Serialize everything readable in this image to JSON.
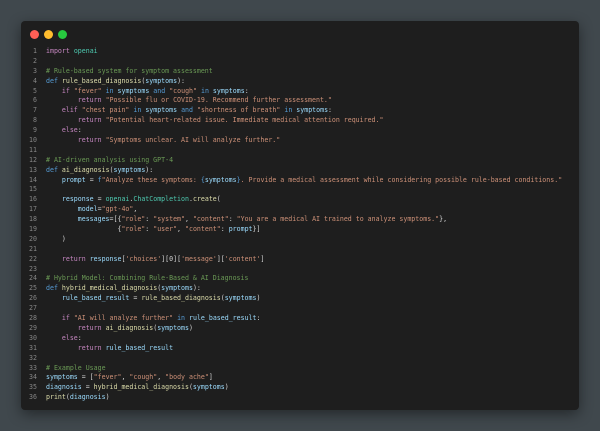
{
  "window": {
    "controls": {
      "close": "#ff5f56",
      "minimize": "#ffbd2e",
      "maximize": "#27c93f"
    }
  },
  "code": {
    "language": "python",
    "lines": [
      [
        [
          "kw",
          "import"
        ],
        [
          "pl",
          " "
        ],
        [
          "mod",
          "openai"
        ]
      ],
      [],
      [
        [
          "cm",
          "# Rule-based system for symptom assessment"
        ]
      ],
      [
        [
          "kb",
          "def"
        ],
        [
          "pl",
          " "
        ],
        [
          "fn",
          "rule_based_diagnosis"
        ],
        [
          "pl",
          "("
        ],
        [
          "var",
          "symptoms"
        ],
        [
          "pl",
          "):"
        ]
      ],
      [
        [
          "pl",
          "    "
        ],
        [
          "kw",
          "if"
        ],
        [
          "pl",
          " "
        ],
        [
          "str",
          "\"fever\""
        ],
        [
          "pl",
          " "
        ],
        [
          "kb",
          "in"
        ],
        [
          "pl",
          " "
        ],
        [
          "var",
          "symptoms"
        ],
        [
          "pl",
          " "
        ],
        [
          "kb",
          "and"
        ],
        [
          "pl",
          " "
        ],
        [
          "str",
          "\"cough\""
        ],
        [
          "pl",
          " "
        ],
        [
          "kb",
          "in"
        ],
        [
          "pl",
          " "
        ],
        [
          "var",
          "symptoms"
        ],
        [
          "pl",
          ":"
        ]
      ],
      [
        [
          "pl",
          "        "
        ],
        [
          "kw",
          "return"
        ],
        [
          "pl",
          " "
        ],
        [
          "str",
          "\"Possible flu or COVID-19. Recommend further assessment.\""
        ]
      ],
      [
        [
          "pl",
          "    "
        ],
        [
          "kw",
          "elif"
        ],
        [
          "pl",
          " "
        ],
        [
          "str",
          "\"chest pain\""
        ],
        [
          "pl",
          " "
        ],
        [
          "kb",
          "in"
        ],
        [
          "pl",
          " "
        ],
        [
          "var",
          "symptoms"
        ],
        [
          "pl",
          " "
        ],
        [
          "kb",
          "and"
        ],
        [
          "pl",
          " "
        ],
        [
          "str",
          "\"shortness of breath\""
        ],
        [
          "pl",
          " "
        ],
        [
          "kb",
          "in"
        ],
        [
          "pl",
          " "
        ],
        [
          "var",
          "symptoms"
        ],
        [
          "pl",
          ":"
        ]
      ],
      [
        [
          "pl",
          "        "
        ],
        [
          "kw",
          "return"
        ],
        [
          "pl",
          " "
        ],
        [
          "str",
          "\"Potential heart-related issue. Immediate medical attention required.\""
        ]
      ],
      [
        [
          "pl",
          "    "
        ],
        [
          "kw",
          "else"
        ],
        [
          "pl",
          ":"
        ]
      ],
      [
        [
          "pl",
          "        "
        ],
        [
          "kw",
          "return"
        ],
        [
          "pl",
          " "
        ],
        [
          "str",
          "\"Symptoms unclear. AI will analyze further.\""
        ]
      ],
      [],
      [
        [
          "cm",
          "# AI-driven analysis using GPT-4"
        ]
      ],
      [
        [
          "kb",
          "def"
        ],
        [
          "pl",
          " "
        ],
        [
          "fn",
          "ai_diagnosis"
        ],
        [
          "pl",
          "("
        ],
        [
          "var",
          "symptoms"
        ],
        [
          "pl",
          "):"
        ]
      ],
      [
        [
          "pl",
          "    "
        ],
        [
          "var",
          "prompt"
        ],
        [
          "pl",
          " = "
        ],
        [
          "kb",
          "f"
        ],
        [
          "str",
          "\"Analyze these symptoms: "
        ],
        [
          "kb",
          "{"
        ],
        [
          "var",
          "symptoms"
        ],
        [
          "kb",
          "}"
        ],
        [
          "str",
          ". Provide a medical assessment while considering possible rule-based conditions.\""
        ]
      ],
      [],
      [
        [
          "pl",
          "    "
        ],
        [
          "var",
          "response"
        ],
        [
          "pl",
          " = "
        ],
        [
          "mod",
          "openai"
        ],
        [
          "pl",
          "."
        ],
        [
          "mod",
          "ChatCompletion"
        ],
        [
          "pl",
          "."
        ],
        [
          "fn",
          "create"
        ],
        [
          "pl",
          "("
        ]
      ],
      [
        [
          "pl",
          "        "
        ],
        [
          "var",
          "model"
        ],
        [
          "pl",
          "="
        ],
        [
          "str",
          "\"gpt-4o\""
        ],
        [
          "pl",
          ","
        ]
      ],
      [
        [
          "pl",
          "        "
        ],
        [
          "var",
          "messages"
        ],
        [
          "pl",
          "=[{"
        ],
        [
          "str",
          "\"role\""
        ],
        [
          "pl",
          ": "
        ],
        [
          "str",
          "\"system\""
        ],
        [
          "pl",
          ", "
        ],
        [
          "str",
          "\"content\""
        ],
        [
          "pl",
          ": "
        ],
        [
          "str",
          "\"You are a medical AI trained to analyze symptoms.\""
        ],
        [
          "pl",
          "},"
        ]
      ],
      [
        [
          "pl",
          "                  {"
        ],
        [
          "str",
          "\"role\""
        ],
        [
          "pl",
          ": "
        ],
        [
          "str",
          "\"user\""
        ],
        [
          "pl",
          ", "
        ],
        [
          "str",
          "\"content\""
        ],
        [
          "pl",
          ": "
        ],
        [
          "var",
          "prompt"
        ],
        [
          "pl",
          "}]"
        ]
      ],
      [
        [
          "pl",
          "    )"
        ]
      ],
      [],
      [
        [
          "pl",
          "    "
        ],
        [
          "kw",
          "return"
        ],
        [
          "pl",
          " "
        ],
        [
          "var",
          "response"
        ],
        [
          "pl",
          "["
        ],
        [
          "str",
          "'choices'"
        ],
        [
          "pl",
          "]["
        ],
        [
          "pl",
          "0"
        ],
        [
          "pl",
          "]["
        ],
        [
          "str",
          "'message'"
        ],
        [
          "pl",
          "]["
        ],
        [
          "str",
          "'content'"
        ],
        [
          "pl",
          "]"
        ]
      ],
      [],
      [
        [
          "cm",
          "# Hybrid Model: Combining Rule-Based & AI Diagnosis"
        ]
      ],
      [
        [
          "kb",
          "def"
        ],
        [
          "pl",
          " "
        ],
        [
          "fn",
          "hybrid_medical_diagnosis"
        ],
        [
          "pl",
          "("
        ],
        [
          "var",
          "symptoms"
        ],
        [
          "pl",
          "):"
        ]
      ],
      [
        [
          "pl",
          "    "
        ],
        [
          "var",
          "rule_based_result"
        ],
        [
          "pl",
          " = "
        ],
        [
          "fn",
          "rule_based_diagnosis"
        ],
        [
          "pl",
          "("
        ],
        [
          "var",
          "symptoms"
        ],
        [
          "pl",
          ")"
        ]
      ],
      [],
      [
        [
          "pl",
          "    "
        ],
        [
          "kw",
          "if"
        ],
        [
          "pl",
          " "
        ],
        [
          "str",
          "\"AI will analyze further\""
        ],
        [
          "pl",
          " "
        ],
        [
          "kb",
          "in"
        ],
        [
          "pl",
          " "
        ],
        [
          "var",
          "rule_based_result"
        ],
        [
          "pl",
          ":"
        ]
      ],
      [
        [
          "pl",
          "        "
        ],
        [
          "kw",
          "return"
        ],
        [
          "pl",
          " "
        ],
        [
          "fn",
          "ai_diagnosis"
        ],
        [
          "pl",
          "("
        ],
        [
          "var",
          "symptoms"
        ],
        [
          "pl",
          ")"
        ]
      ],
      [
        [
          "pl",
          "    "
        ],
        [
          "kw",
          "else"
        ],
        [
          "pl",
          ":"
        ]
      ],
      [
        [
          "pl",
          "        "
        ],
        [
          "kw",
          "return"
        ],
        [
          "pl",
          " "
        ],
        [
          "var",
          "rule_based_result"
        ]
      ],
      [],
      [
        [
          "cm",
          "# Example Usage"
        ]
      ],
      [
        [
          "var",
          "symptoms"
        ],
        [
          "pl",
          " = ["
        ],
        [
          "str",
          "\"fever\""
        ],
        [
          "pl",
          ", "
        ],
        [
          "str",
          "\"cough\""
        ],
        [
          "pl",
          ", "
        ],
        [
          "str",
          "\"body ache\""
        ],
        [
          "pl",
          "]"
        ]
      ],
      [
        [
          "var",
          "diagnosis"
        ],
        [
          "pl",
          " = "
        ],
        [
          "fn",
          "hybrid_medical_diagnosis"
        ],
        [
          "pl",
          "("
        ],
        [
          "var",
          "symptoms"
        ],
        [
          "pl",
          ")"
        ]
      ],
      [
        [
          "fn",
          "print"
        ],
        [
          "pl",
          "("
        ],
        [
          "var",
          "diagnosis"
        ],
        [
          "pl",
          ")"
        ]
      ]
    ]
  }
}
